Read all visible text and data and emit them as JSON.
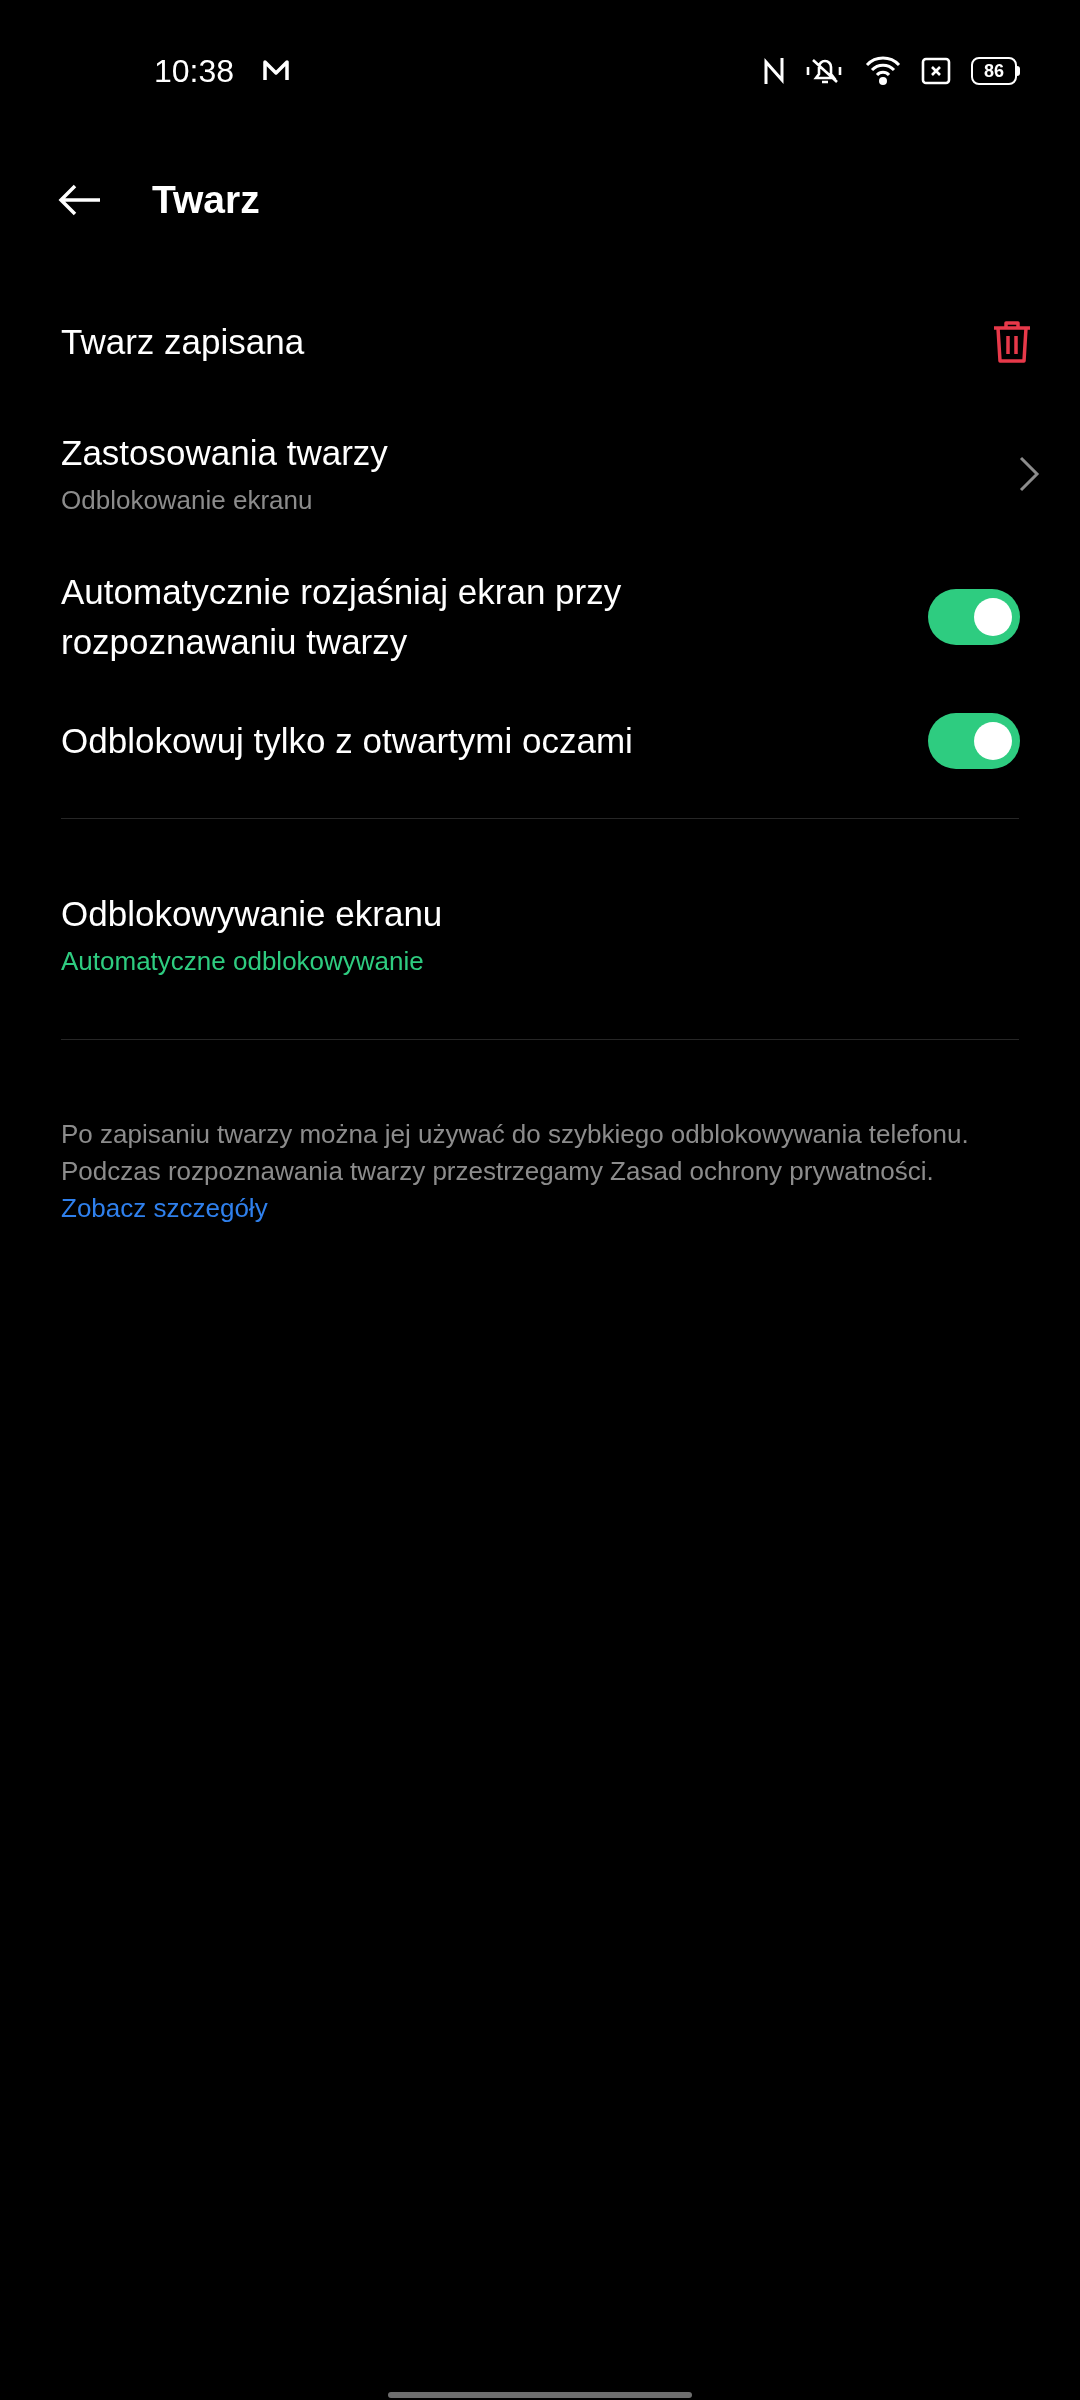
{
  "status_bar": {
    "time": "10:38",
    "battery": "86"
  },
  "header": {
    "title": "Twarz"
  },
  "items": [
    {
      "kind": "delete",
      "title": "Twarz zapisana"
    },
    {
      "kind": "link",
      "title": "Zastosowania twarzy",
      "subtitle": "Odblokowanie ekranu"
    },
    {
      "kind": "toggle",
      "title": "Automatycznie rozjaśniaj ekran przy rozpoznawaniu twarzy",
      "on": true
    },
    {
      "kind": "toggle",
      "title": "Odblokowuj tylko z otwartymi oczami",
      "on": true
    }
  ],
  "unlock": {
    "title": "Odblokowywanie ekranu",
    "value": "Automatyczne odblokowywanie"
  },
  "footnote": {
    "text": "Po zapisaniu twarzy można jej używać do szybkiego odblokowywania telefonu. Podczas rozpoznawania twarzy przestrzegamy Zasad ochrony prywatności.",
    "link": "Zobacz szczegóły"
  }
}
